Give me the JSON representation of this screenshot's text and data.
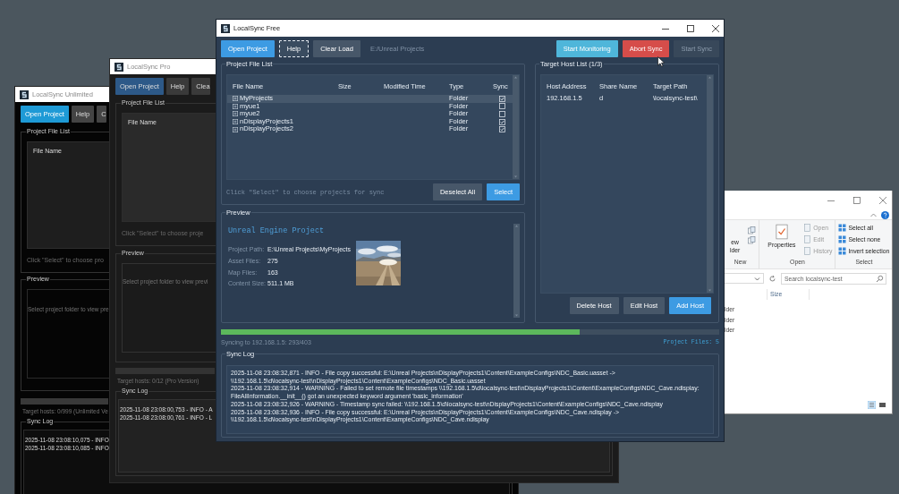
{
  "back_window_unlimited": {
    "title": "LocalSync Unlimited",
    "buttons": [
      {
        "label": "Open Project",
        "kind": "primary"
      },
      {
        "label": "Help",
        "kind": "normal"
      },
      {
        "label": "C",
        "kind": "normal"
      }
    ],
    "file_list": {
      "title": "Project File List",
      "column_1": "File Name",
      "hint": "Click \"Select\" to choose pro"
    },
    "preview": {
      "title": "Preview",
      "hint": "Select project folder to view pre"
    },
    "status": "Target hosts: 0/999 (Unlimited Ve",
    "sync_log": {
      "title": "Sync Log",
      "lines": [
        "2025-11-08 23:08:10,075 - INFO",
        "2025-11-08 23:08:10,085 - INFO"
      ]
    }
  },
  "back_window_pro": {
    "title": "LocalSync Pro",
    "buttons": [
      {
        "label": "Open Project",
        "kind": "primary"
      },
      {
        "label": "Help",
        "kind": "normal"
      },
      {
        "label": "Clea",
        "kind": "normal"
      }
    ],
    "file_list": {
      "title": "Project File List",
      "column_1": "File Name",
      "hint": "Click \"Select\" to choose proje"
    },
    "preview": {
      "title": "Preview",
      "hint": "Select project folder to view previ"
    },
    "status": "Target hosts: 0/12 (Pro Version)",
    "sync_log": {
      "title": "Sync Log",
      "lines": [
        "2025-11-08 23:08:00,753 - INFO - A",
        "2025-11-08 23:08:00,761 - INFO - L"
      ]
    }
  },
  "explorer_window": {
    "ribbon": [
      {
        "label": "New",
        "items": [
          {
            "kind": "large",
            "label": "ew\nlder"
          },
          {
            "kind": "icon"
          },
          {
            "kind": "icon"
          }
        ]
      },
      {
        "label": "Open",
        "items": [
          {
            "kind": "large",
            "label": "Properties"
          },
          {
            "kind": "small",
            "label": "Open",
            "disabled": true
          },
          {
            "kind": "small",
            "label": "Edit",
            "disabled": true
          },
          {
            "kind": "small",
            "label": "History",
            "disabled": true
          }
        ]
      },
      {
        "label": "Select",
        "items": [
          {
            "kind": "small",
            "label": "Select all",
            "disabled": false
          },
          {
            "kind": "small",
            "label": "Select none",
            "disabled": false
          },
          {
            "kind": "small",
            "label": "Invert selection",
            "disabled": false
          }
        ]
      }
    ],
    "search": {
      "placeholder": "Search localsync-test"
    },
    "columns": [
      "Size"
    ],
    "rows": [
      "lder",
      "lder",
      "lder"
    ]
  },
  "main_window": {
    "title": "LocalSync Free",
    "toolbar": {
      "buttons": [
        {
          "label": "Open Project",
          "kind": "primary",
          "disabled": false
        },
        {
          "label": "Help",
          "kind": "focus",
          "disabled": false
        },
        {
          "label": "Clear Load",
          "kind": "normal",
          "disabled": false
        }
      ],
      "path": "E:/Unreal Projects",
      "actions": [
        {
          "label": "Start Monitoring",
          "kind": "info",
          "disabled": false
        },
        {
          "label": "Abort Sync",
          "kind": "danger",
          "disabled": false
        },
        {
          "label": "Start Sync",
          "kind": "normal",
          "disabled": true
        }
      ]
    },
    "file_list": {
      "title": "Project File List",
      "columns": [
        "File Name",
        "Size",
        "Modified Time",
        "Type",
        "Sync"
      ],
      "rows": [
        {
          "name": "MyProjects",
          "type": "Folder",
          "sync": true,
          "selected": true
        },
        {
          "name": "myue1",
          "type": "Folder",
          "sync": false,
          "selected": false
        },
        {
          "name": "myue2",
          "type": "Folder",
          "sync": false,
          "selected": false
        },
        {
          "name": "nDisplayProjects1",
          "type": "Folder",
          "sync": true,
          "selected": false
        },
        {
          "name": "nDisplayProjects2",
          "type": "Folder",
          "sync": true,
          "selected": false
        }
      ],
      "hint": "Click \"Select\" to choose projects for sync",
      "buttons": [
        {
          "label": "Deselect All",
          "kind": "normal"
        },
        {
          "label": "Select",
          "kind": "primary"
        }
      ]
    },
    "preview": {
      "title": "Preview",
      "heading": "Unreal Engine Project",
      "fields": [
        {
          "label": "Project Path:",
          "value": "E:\\Unreal Projects\\MyProjects"
        },
        {
          "label": "Asset Files:",
          "value": "275"
        },
        {
          "label": "Map Files:",
          "value": "163"
        },
        {
          "label": "Content Size:",
          "value": "511.1 MB"
        }
      ]
    },
    "hosts": {
      "title": "Target Host List (1/3)",
      "columns": [
        "Host Address",
        "Share Name",
        "Target Path"
      ],
      "rows": [
        {
          "address": "192.168.1.5",
          "share": "d",
          "path": "\\localsync-test\\"
        }
      ],
      "buttons": [
        {
          "label": "Delete Host",
          "kind": "normal"
        },
        {
          "label": "Edit Host",
          "kind": "normal"
        },
        {
          "label": "Add Host",
          "kind": "primary"
        }
      ]
    },
    "progress": {
      "level": 0.72,
      "status": "Syncing to 192.168.1.5: 293/403",
      "count": "Project Files: 5"
    },
    "sync_log": {
      "title": "Sync Log",
      "lines": [
        "2025-11-08 23:08:32,871 - INFO - File copy successful: E:\\Unreal Projects\\nDisplayProjects1\\Content\\ExampleConfigs\\NDC_Basic.uasset ->",
        "\\\\192.168.1.5\\d\\localsync-test\\nDisplayProjects1\\Content\\ExampleConfigs\\NDC_Basic.uasset",
        "2025-11-08 23:08:32,914 - WARNING - Failed to set remote file timestamps \\\\192.168.1.5\\d\\localsync-test\\nDisplayProjects1\\Content\\ExampleConfigs\\NDC_Cave.ndisplay:",
        "FileAllInformation.__init__() got an unexpected keyword argument 'basic_information'",
        "2025-11-08 23:08:32,926 - WARNING - Timestamp sync failed: \\\\192.168.1.5\\d\\localsync-test\\nDisplayProjects1\\Content\\ExampleConfigs\\NDC_Cave.ndisplay",
        "2025-11-08 23:08:32,936 - INFO - File copy successful: E:\\Unreal Projects\\nDisplayProjects1\\Content\\ExampleConfigs\\NDC_Cave.ndisplay ->",
        "\\\\192.168.1.5\\d\\localsync-test\\nDisplayProjects1\\Content\\ExampleConfigs\\NDC_Cave.ndisplay"
      ]
    }
  }
}
